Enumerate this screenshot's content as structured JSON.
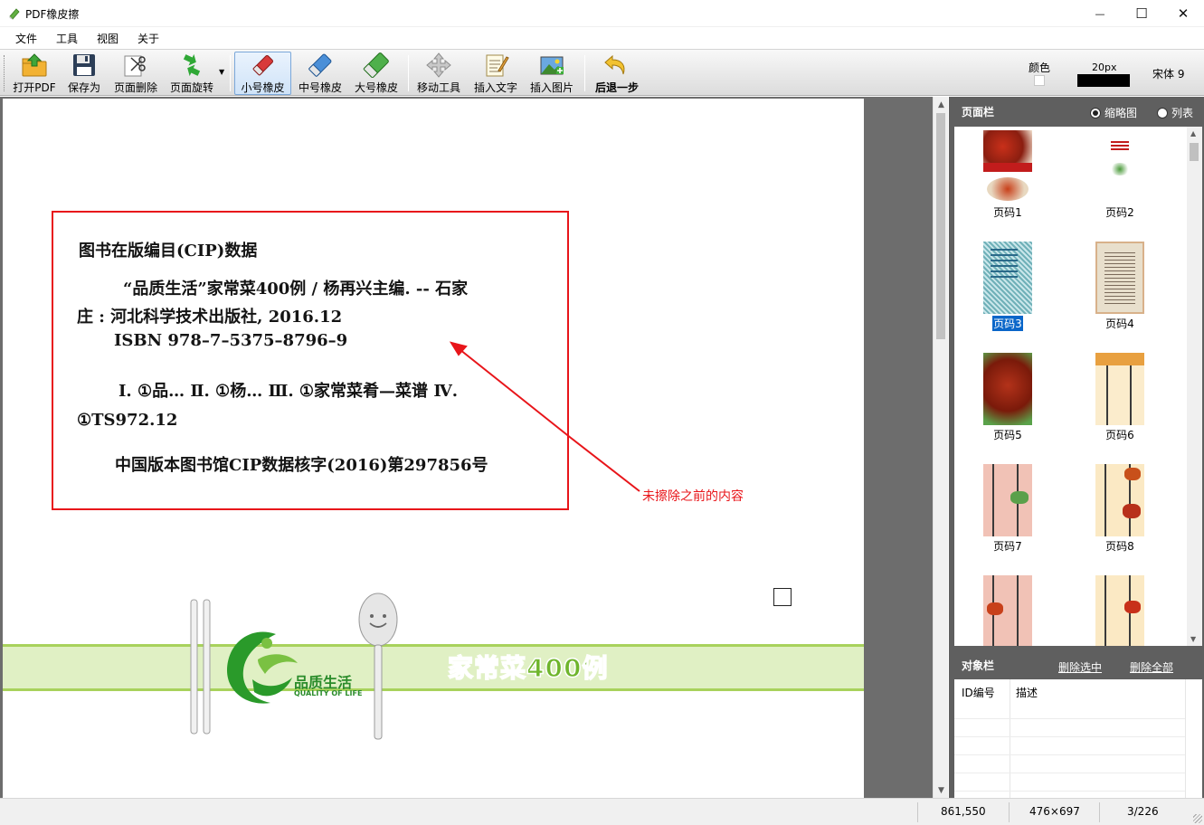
{
  "window": {
    "title": "PDF橡皮擦",
    "controls": {
      "minimize": "—",
      "maximize": "☐",
      "close": "✕"
    }
  },
  "menu": [
    "文件",
    "工具",
    "视图",
    "关于"
  ],
  "toolbar": {
    "open_pdf": "打开PDF",
    "save_as": "保存为",
    "page_delete": "页面删除",
    "page_rotate": "页面旋转",
    "small_eraser": "小号橡皮",
    "medium_eraser": "中号橡皮",
    "large_eraser": "大号橡皮",
    "move_tool": "移动工具",
    "insert_text": "插入文字",
    "insert_image": "插入图片",
    "undo": "后退一步",
    "color_label": "颜色",
    "size_label": "20px",
    "font_label": "宋体 9",
    "colors": {
      "active_tool_border": "#7aa7d9",
      "swatch": "#000000"
    }
  },
  "document": {
    "cip_lines": [
      "图书在版编目(CIP)数据",
      "“品质生活”家常菜400例 / 杨再兴主编. -- 石家",
      "庄 : 河北科学技术出版社, 2016.12",
      "ISBN 978–7–5375–8796–9",
      "Ⅰ. ①品…  Ⅱ. ①杨…  Ⅲ. ①家常菜肴—菜谱  Ⅳ.",
      "①TS972.12",
      "中国版本图书馆CIP数据核字(2016)第297856号"
    ],
    "annotation": "未擦除之前的内容",
    "annotation_color": "#e8151a",
    "logo_text": "品质生活",
    "logo_subtext": "QUALITY OF LIFE",
    "banner_title": "家常菜400例"
  },
  "page_panel": {
    "title": "页面栏",
    "view_thumb": "缩略图",
    "view_list": "列表",
    "selected_view": "缩略图",
    "pages": [
      "页码1",
      "页码2",
      "页码3",
      "页码4",
      "页码5",
      "页码6",
      "页码7",
      "页码8",
      "",
      ""
    ],
    "selected_page": "页码3"
  },
  "object_panel": {
    "title": "对象栏",
    "delete_selected": "删除选中",
    "delete_all": "删除全部",
    "columns": [
      "ID编号",
      "描述"
    ]
  },
  "status": {
    "coords": "861,550",
    "page_size": "476×697",
    "page_index": "3/226"
  }
}
